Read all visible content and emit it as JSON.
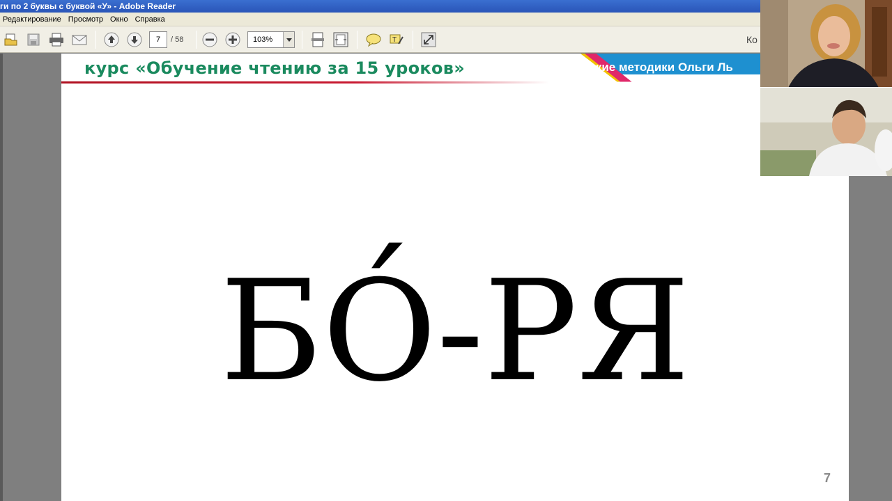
{
  "window": {
    "title": "ги по 2 буквы с буквой «У» - Adobe Reader"
  },
  "menu": {
    "items": [
      {
        "label": "Редактирование"
      },
      {
        "label": "Просмотр"
      },
      {
        "label": "Окно"
      },
      {
        "label": "Справка"
      }
    ]
  },
  "toolbar": {
    "page_current": "7",
    "page_total": "/ 58",
    "zoom": "103%",
    "search_partial": "Ко",
    "icons": [
      "open-icon",
      "save-icon",
      "print-icon",
      "email-icon",
      "page-up-icon",
      "page-down-icon",
      "zoom-out-icon",
      "zoom-in-icon",
      "fit-page-icon",
      "fit-width-icon",
      "comment-icon",
      "highlight-icon",
      "fullscreen-icon"
    ]
  },
  "document": {
    "course_title": "курс «Обучение чтению за 15 уроков»",
    "banner_text": "Авторские методики Ольги Ль",
    "syllable_1": "БО́",
    "hyphen": "-",
    "syllable_2": "РЯ",
    "page_number": "7",
    "colors": {
      "course_title": "#1a8a5e",
      "banner_blue": "#1e90d0",
      "banner_pink": "#e0286a",
      "banner_yellow": "#f2c200"
    }
  },
  "webcams": {
    "teacher": "teacher-webcam",
    "child": "child-webcam"
  }
}
